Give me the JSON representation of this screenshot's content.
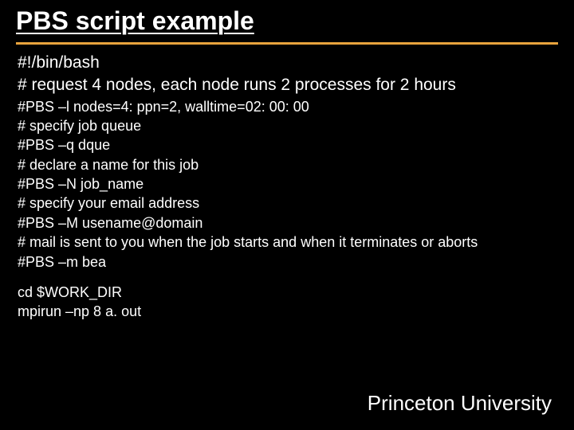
{
  "title": "PBS script example",
  "body": {
    "large": [
      "#!/bin/bash",
      "# request 4 nodes,  each node runs 2 processes for 2 hours"
    ],
    "small1": [
      "#PBS –l nodes=4: ppn=2, walltime=02: 00: 00",
      "# specify job queue",
      "#PBS –q dque",
      "# declare a name for this job",
      "#PBS –N job_name",
      "# specify your email address",
      "#PBS –M usename@domain",
      "# mail is sent to you when the job starts and when it terminates or aborts",
      "#PBS –m bea"
    ],
    "small2": [
      "cd $WORK_DIR",
      "mpirun –np 8 a. out"
    ]
  },
  "footer": "Princeton University"
}
